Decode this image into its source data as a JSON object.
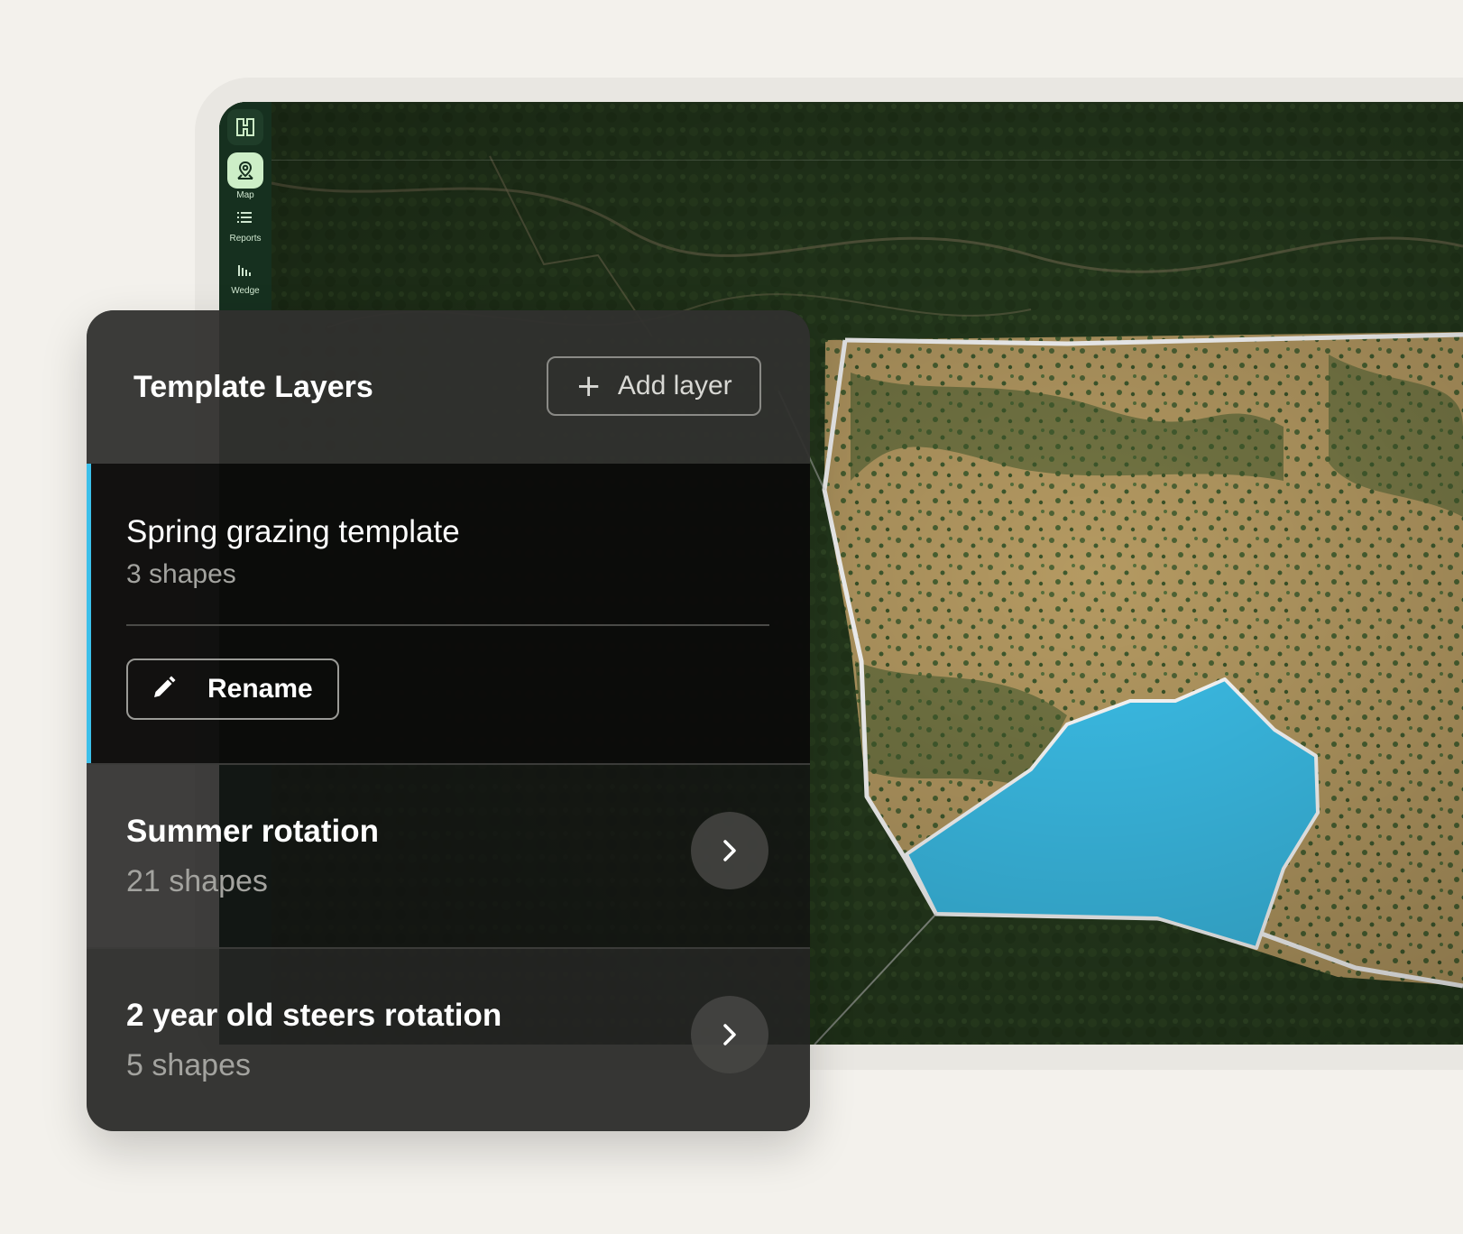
{
  "rail": {
    "items": [
      {
        "label": "Map",
        "icon": "map-pin-icon",
        "active": true
      },
      {
        "label": "Reports",
        "icon": "list-icon",
        "active": false
      },
      {
        "label": "Wedge",
        "icon": "bar-chart-icon",
        "active": false
      }
    ]
  },
  "panel": {
    "title": "Template Layers",
    "add_layer_label": "Add layer",
    "active_layer": {
      "name": "Spring grazing template",
      "count": "3 shapes",
      "rename_label": "Rename"
    },
    "layers": [
      {
        "name": "Summer rotation",
        "count": "21 shapes"
      },
      {
        "name": "2 year old steers rotation",
        "count": "5 shapes"
      }
    ]
  },
  "colors": {
    "accent": "#3cc0ea",
    "shape_fill": "#3cc0ea",
    "rail_bg": "#16301f",
    "rail_active": "#cdeec7"
  }
}
